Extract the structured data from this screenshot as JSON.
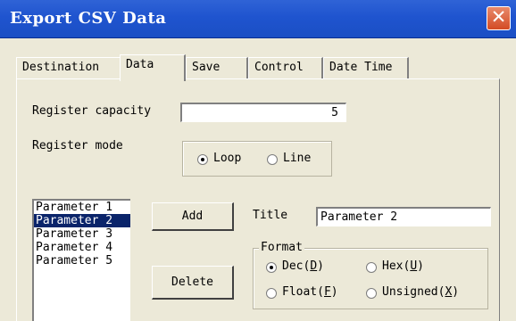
{
  "window": {
    "title": "Export CSV Data",
    "close_glyph": "✕"
  },
  "tabs": [
    {
      "label": "Destination",
      "active": false
    },
    {
      "label": "Data",
      "active": true
    },
    {
      "label": "Save",
      "active": false
    },
    {
      "label": "Control",
      "active": false
    },
    {
      "label": "Date Time",
      "active": false
    }
  ],
  "register_capacity": {
    "label": "Register capacity",
    "value": "5"
  },
  "register_mode": {
    "label": "Register mode",
    "options": [
      {
        "label": "Loop",
        "checked": true
      },
      {
        "label": "Line",
        "checked": false
      }
    ]
  },
  "parameters": {
    "items": [
      "Parameter 1",
      "Parameter 2",
      "Parameter 3",
      "Parameter 4",
      "Parameter 5"
    ],
    "selected": "Parameter 2"
  },
  "buttons": {
    "add": "Add",
    "delete": "Delete"
  },
  "title_field": {
    "label": "Title",
    "value": "Parameter 2"
  },
  "format": {
    "label": "Format",
    "options": [
      {
        "label": "Dec",
        "key": "D",
        "checked": true
      },
      {
        "label": "Hex",
        "key": "U",
        "checked": false
      },
      {
        "label": "Float",
        "key": "F",
        "checked": false
      },
      {
        "label": "Unsigned",
        "key": "X",
        "checked": false
      }
    ]
  }
}
